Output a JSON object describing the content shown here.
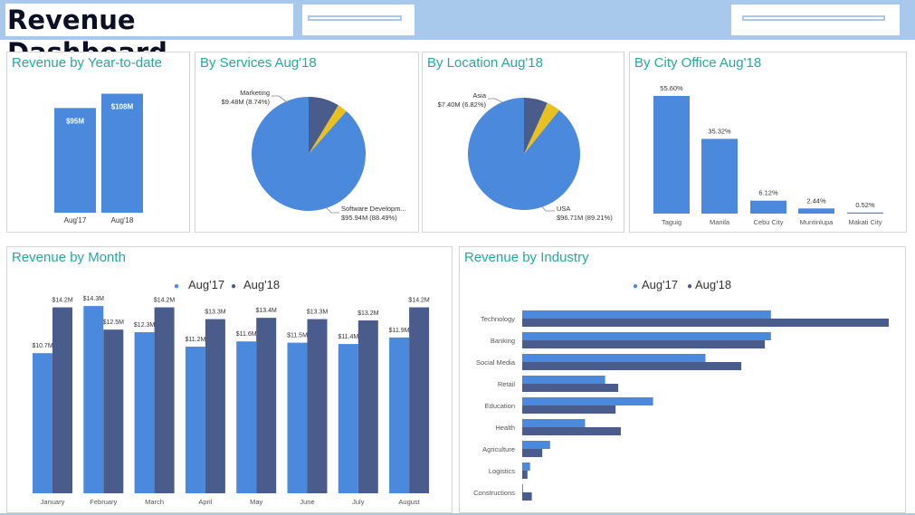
{
  "header": {
    "title": "Revenue Dashboard"
  },
  "colors": {
    "aug17": "#4a89dc",
    "aug18": "#4a5c8c",
    "accent": "#e8c020",
    "title": "#2aa79b",
    "header_bg": "#a8c8ec"
  },
  "panels": {
    "ytd": {
      "title": "Revenue by Year-to-date"
    },
    "services": {
      "title": "By Services Aug'18"
    },
    "location": {
      "title": "By Location Aug'18"
    },
    "city": {
      "title": "By City Office Aug'18"
    },
    "month": {
      "title": "Revenue by Month"
    },
    "industry": {
      "title": "Revenue by Industry"
    }
  },
  "chart_data": [
    {
      "type": "bar",
      "title": "Revenue by Year-to-date",
      "categories": [
        "Aug'17",
        "Aug'18"
      ],
      "values": [
        95,
        108
      ],
      "value_labels": [
        "$95M",
        "$108M"
      ],
      "ylim": [
        0,
        115
      ]
    },
    {
      "type": "pie",
      "title": "By Services Aug'18",
      "slices": [
        {
          "name": "Software Developm...",
          "label": "$95.94M (88.49%)",
          "share": 88.49,
          "color": "#4a89dc"
        },
        {
          "name": "",
          "label": "",
          "share": 2.77,
          "color": "#e8c020"
        },
        {
          "name": "Marketing",
          "label": "$9.48M (8.74%)",
          "share": 8.74,
          "color": "#4a5c8c"
        }
      ]
    },
    {
      "type": "pie",
      "title": "By Location Aug'18",
      "slices": [
        {
          "name": "USA",
          "label": "$96.71M (89.21%)",
          "share": 89.21,
          "color": "#4a89dc"
        },
        {
          "name": "",
          "label": "",
          "share": 3.97,
          "color": "#e8c020"
        },
        {
          "name": "Asia",
          "label": "$7.40M (6.82%)",
          "share": 6.82,
          "color": "#4a5c8c"
        }
      ]
    },
    {
      "type": "bar",
      "title": "By City Office Aug'18",
      "categories": [
        "Taguig",
        "Manila",
        "Cebu City",
        "Muntinlupa",
        "Makati City"
      ],
      "values": [
        55.6,
        35.32,
        6.12,
        2.44,
        0.52
      ],
      "value_labels": [
        "55.60%",
        "35.32%",
        "6.12%",
        "2.44%",
        "0.52%"
      ],
      "ylim": [
        0,
        62
      ]
    },
    {
      "type": "bar",
      "title": "Revenue by Month",
      "categories": [
        "January",
        "February",
        "March",
        "April",
        "May",
        "June",
        "July",
        "August"
      ],
      "series": [
        {
          "name": "Aug'17",
          "values": [
            10.7,
            14.3,
            12.3,
            11.2,
            11.6,
            11.5,
            11.4,
            11.9
          ],
          "value_labels": [
            "$10.7M",
            "$14.3M",
            "$12.3M",
            "$11.2M",
            "$11.6M",
            "$11.5M",
            "$11.4M",
            "$11.9M"
          ]
        },
        {
          "name": "Aug'18",
          "values": [
            14.2,
            12.5,
            14.2,
            13.3,
            13.4,
            13.3,
            13.2,
            14.2
          ],
          "value_labels": [
            "$14.2M",
            "$12.5M",
            "$14.2M",
            "$13.3M",
            "$13.4M",
            "$13.3M",
            "$13.2M",
            "$14.2M"
          ]
        }
      ],
      "ylim": [
        0,
        15
      ]
    },
    {
      "type": "bar",
      "orientation": "horizontal",
      "title": "Revenue by Industry",
      "categories": [
        "Technology",
        "Banking",
        "Social Media",
        "Retail",
        "Education",
        "Health",
        "Agriculture",
        "Logistics",
        "Constructions"
      ],
      "series": [
        {
          "name": "Aug'17",
          "values": [
            28.5,
            28.5,
            21,
            9.5,
            15,
            7.2,
            3.2,
            0.9,
            0.1
          ]
        },
        {
          "name": "Aug'18",
          "values": [
            42,
            27.8,
            25.1,
            11,
            10.7,
            11.3,
            2.3,
            0.6,
            1.1
          ]
        }
      ],
      "xlim": [
        0,
        42
      ]
    }
  ]
}
